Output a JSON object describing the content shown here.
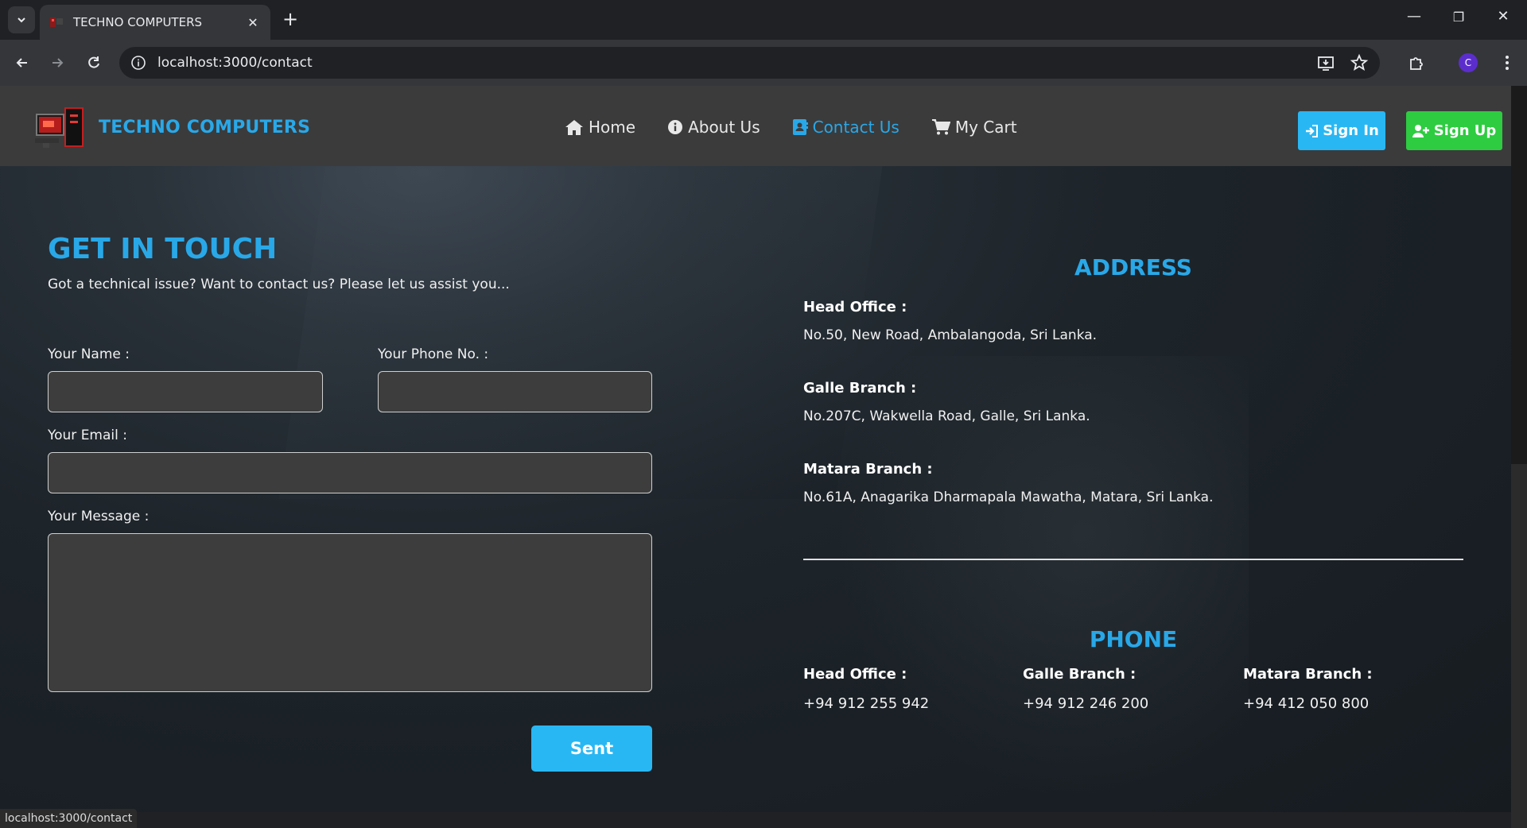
{
  "browser": {
    "tab_title": "TECHNO COMPUTERS",
    "tab_close": "✕",
    "new_tab": "+",
    "url": "localhost:3000/contact",
    "profile_initial": "C",
    "status_url": "localhost:3000/contact",
    "window_controls": {
      "minimize": "—",
      "restore": "❐",
      "close": "✕"
    }
  },
  "header": {
    "brand": "TECHNO COMPUTERS",
    "nav": [
      {
        "label": "Home",
        "icon": "home-icon"
      },
      {
        "label": "About Us",
        "icon": "info-icon"
      },
      {
        "label": "Contact Us",
        "icon": "contact-card-icon",
        "active": true
      },
      {
        "label": "My Cart",
        "icon": "cart-icon"
      }
    ],
    "signin_label": "Sign In",
    "signup_label": "Sign Up"
  },
  "contact_form": {
    "title": "GET IN TOUCH",
    "subtitle": "Got a technical issue? Want to contact us? Please let us assist you...",
    "name_label": "Your Name :",
    "phone_label": "Your Phone No. :",
    "email_label": "Your Email :",
    "message_label": "Your Message :",
    "name_value": "",
    "phone_value": "",
    "email_value": "",
    "message_value": "",
    "submit_label": "Sent"
  },
  "address": {
    "title": "ADDRESS",
    "branches": [
      {
        "label": "Head Office :",
        "value": "No.50, New Road, Ambalangoda, Sri Lanka."
      },
      {
        "label": "Galle Branch :",
        "value": "No.207C, Wakwella Road, Galle, Sri Lanka."
      },
      {
        "label": "Matara Branch :",
        "value": "No.61A, Anagarika Dharmapala Mawatha, Matara, Sri Lanka."
      }
    ]
  },
  "phone": {
    "title": "PHONE",
    "branches": [
      {
        "label": "Head Office :",
        "value": "+94 912 255 942"
      },
      {
        "label": "Galle Branch :",
        "value": "+94 912 246 200"
      },
      {
        "label": "Matara Branch :",
        "value": "+94 412 050 800"
      }
    ]
  },
  "colors": {
    "accent": "#29a8e8",
    "signin_bg": "#29b7f3",
    "signup_bg": "#2ecc40",
    "header_bg": "#3b3b3c"
  }
}
